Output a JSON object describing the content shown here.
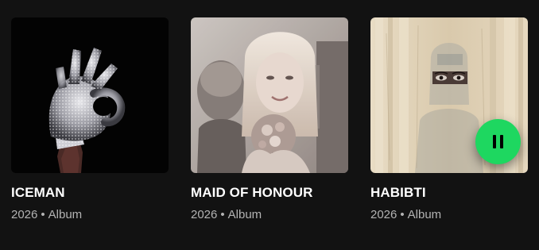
{
  "colors": {
    "background": "#121212",
    "accent": "#1ed760",
    "subtext": "#b3b3b3"
  },
  "albums": [
    {
      "title": "ICEMAN",
      "year": "2026",
      "separator": "•",
      "type": "Album"
    },
    {
      "title": "MAID OF HONOUR",
      "year": "2026",
      "separator": "•",
      "type": "Album"
    },
    {
      "title": "HABIBTI",
      "year": "2026",
      "separator": "•",
      "type": "Album",
      "playing": true,
      "control_icon": "pause-icon"
    }
  ]
}
